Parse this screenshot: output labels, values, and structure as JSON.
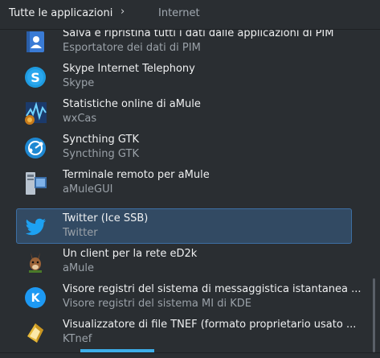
{
  "breadcrumb": {
    "root": "Tutte le applicazioni",
    "separator": "›",
    "current": "Internet"
  },
  "apps": [
    {
      "title": "Salva e ripristina tutti i dati dalle applicazioni di PIM",
      "subtitle": "Esportatore dei dati di PIM",
      "icon": "pim-export-icon"
    },
    {
      "title": "Skype Internet Telephony",
      "subtitle": "Skype",
      "icon": "skype-icon"
    },
    {
      "title": "Statistiche online di aMule",
      "subtitle": "wxCas",
      "icon": "wxcas-icon"
    },
    {
      "title": "Syncthing GTK",
      "subtitle": "Syncthing GTK",
      "icon": "syncthing-icon"
    },
    {
      "title": "Terminale remoto per aMule",
      "subtitle": "aMuleGUI",
      "icon": "amulegui-icon"
    },
    {
      "title": "Twitter (Ice SSB)",
      "subtitle": "Twitter",
      "icon": "twitter-icon"
    },
    {
      "title": "Un client per la rete eD2k",
      "subtitle": "aMule",
      "icon": "amule-icon"
    },
    {
      "title": "Visore registri del sistema di messaggistica istantanea ...",
      "subtitle": "Visore registri del sistema MI di KDE",
      "icon": "kde-log-viewer-icon"
    },
    {
      "title": "Visualizzatore di file TNEF (formato proprietario usato ...",
      "subtitle": "KTnef",
      "icon": "ktnef-icon"
    }
  ],
  "colors": {
    "background": "#2a2e32",
    "selection": "#324a63",
    "accent": "#3daee9"
  }
}
